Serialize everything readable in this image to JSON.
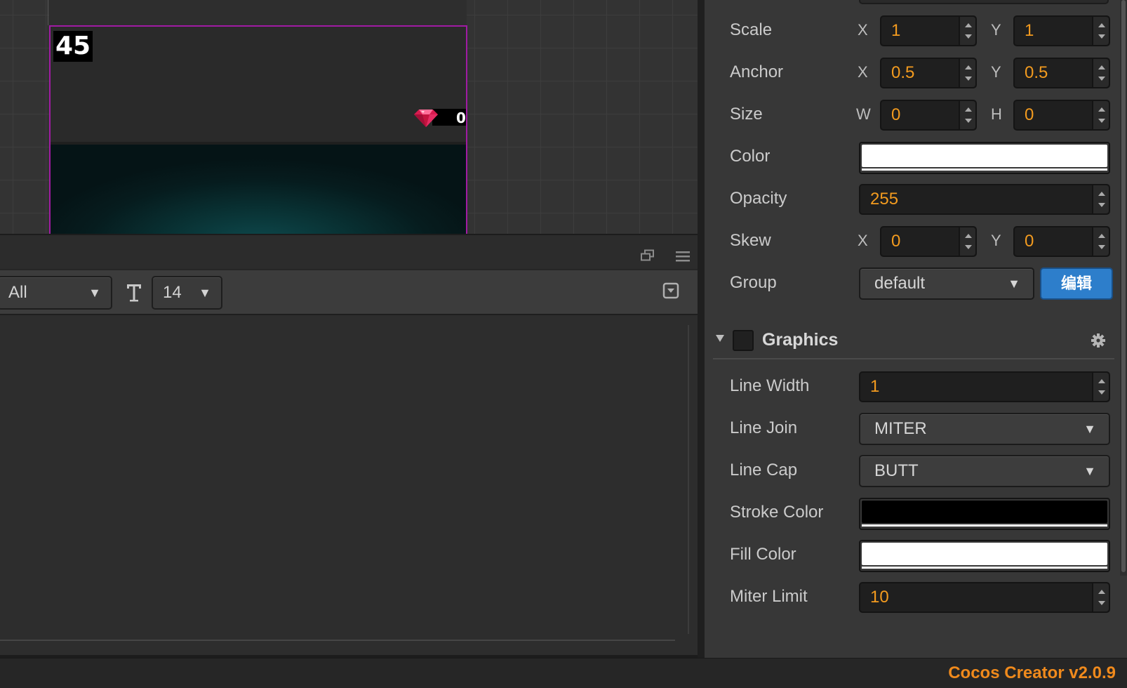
{
  "scene": {
    "score": "45",
    "gem_count": "0"
  },
  "console": {
    "filter_value": "All",
    "font_size_value": "14"
  },
  "inspector": {
    "scale": {
      "label": "Scale",
      "x_label": "X",
      "x": "1",
      "y_label": "Y",
      "y": "1"
    },
    "anchor": {
      "label": "Anchor",
      "x_label": "X",
      "x": "0.5",
      "y_label": "Y",
      "y": "0.5"
    },
    "size": {
      "label": "Size",
      "w_label": "W",
      "w": "0",
      "h_label": "H",
      "h": "0"
    },
    "color": {
      "label": "Color",
      "value": "#ffffff"
    },
    "opacity": {
      "label": "Opacity",
      "value": "255"
    },
    "skew": {
      "label": "Skew",
      "x_label": "X",
      "x": "0",
      "y_label": "Y",
      "y": "0"
    },
    "group": {
      "label": "Group",
      "value": "default",
      "edit_label": "编辑"
    },
    "graphics": {
      "title": "Graphics",
      "line_width": {
        "label": "Line Width",
        "value": "1"
      },
      "line_join": {
        "label": "Line Join",
        "value": "MITER"
      },
      "line_cap": {
        "label": "Line Cap",
        "value": "BUTT"
      },
      "stroke_color": {
        "label": "Stroke Color",
        "value": "#000000"
      },
      "fill_color": {
        "label": "Fill Color",
        "value": "#ffffff"
      },
      "miter_limit": {
        "label": "Miter Limit",
        "value": "10"
      }
    }
  },
  "statusbar": {
    "version": "Cocos Creator v2.0.9"
  },
  "colors": {
    "accent_orange": "#f39b1f",
    "selection_magenta": "#a01ba3",
    "edit_button_blue": "#2d7ecb"
  },
  "icons": [
    "gem-icon",
    "plus-circle-icon",
    "detach-window-icon",
    "menu-icon",
    "font-size-icon",
    "collapse-icon",
    "chevron-down-icon",
    "fold-triangle-icon",
    "gear-icon",
    "spinner-up-icon",
    "spinner-down-icon"
  ]
}
